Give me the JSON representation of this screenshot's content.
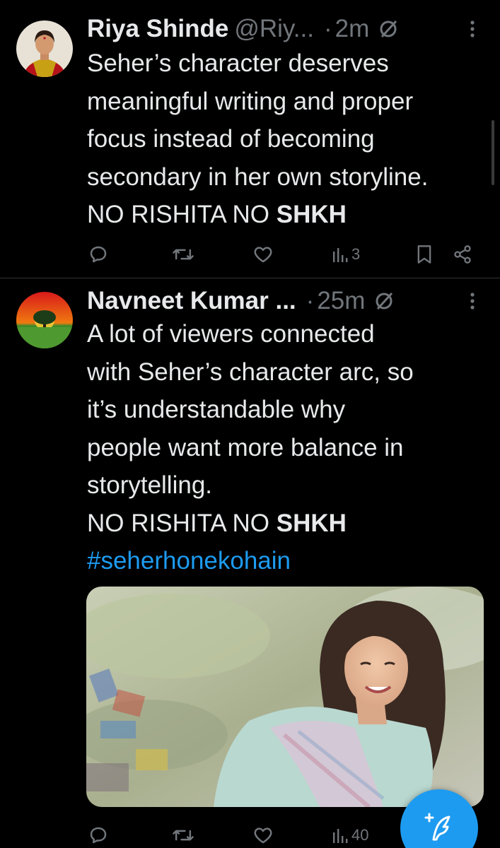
{
  "tweets": [
    {
      "author_name": "Riya Shinde",
      "author_handle": "@Riy...",
      "time": "2m",
      "lines": [
        "Seher’s character deserves",
        "meaningful writing and proper",
        "focus instead of becoming",
        "secondary in her own storyline."
      ],
      "tag_line_prefix": "NO RISHITA NO ",
      "tag_line_bold": "SHKH",
      "views": "3"
    },
    {
      "author_name": "Navneet Kumar ...",
      "time": "25m",
      "lines": [
        "A lot of viewers connected",
        "with Seher’s character arc, so",
        "it’s understandable why",
        "people want more balance in",
        "storytelling."
      ],
      "tag_line_prefix": "NO RISHITA NO ",
      "tag_line_bold": "SHKH",
      "hashtag": "#seherhonekohain",
      "views": "40"
    }
  ],
  "colors": {
    "background": "#000000",
    "text": "#e7e9ea",
    "secondary_text": "#71767b",
    "accent": "#1d9bf0",
    "divider": "#2f3336"
  },
  "icons": [
    "reply-icon",
    "retweet-icon",
    "like-icon",
    "views-icon",
    "bookmark-icon",
    "share-icon",
    "more-icon",
    "grok-icon",
    "compose-icon"
  ]
}
